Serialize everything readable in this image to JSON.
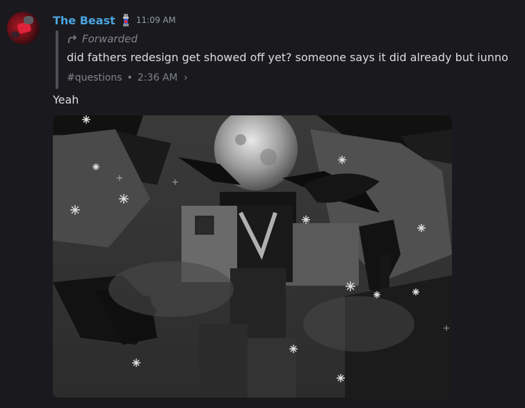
{
  "message": {
    "author": "The Beast",
    "timestamp": "11:09 AM",
    "avatar_icon": "avatar-icon",
    "role_icon": "tower-role-icon",
    "forward": {
      "label": "Forwarded",
      "text": "did fathers redesign get showed off yet? someone says it did already but iunno",
      "channel": "#questions",
      "separator": "•",
      "time": "2:36 AM",
      "chevron": "›"
    },
    "reply": "Yeah",
    "attachment_icon": "roblox-character-image"
  },
  "colors": {
    "background": "#1a1a1e",
    "username": "#4aa3df",
    "muted": "#949ba4",
    "text": "#dbdee1",
    "forward_bar": "#4e5058"
  }
}
